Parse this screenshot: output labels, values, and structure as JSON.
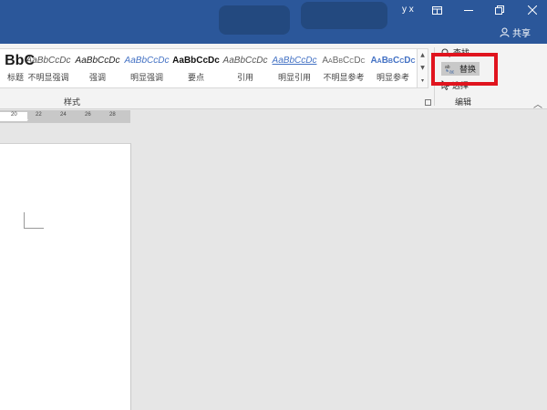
{
  "titlebar": {
    "user": "y x",
    "share_label": "共享"
  },
  "styles": {
    "group_label": "样式",
    "items": [
      {
        "sample": "BbC",
        "name": "标题"
      },
      {
        "sample": "AaBbCcDc",
        "name": "不明显强调"
      },
      {
        "sample": "AaBbCcDc",
        "name": "强调"
      },
      {
        "sample": "AaBbCcDc",
        "name": "明显强调"
      },
      {
        "sample": "AaBbCcDc",
        "name": "要点"
      },
      {
        "sample": "AaBbCcDc",
        "name": "引用"
      },
      {
        "sample": "AaBbCcDc",
        "name": "明显引用"
      },
      {
        "sample": "AaBbCcDc",
        "name": "不明显参考"
      },
      {
        "sample": "AaBbCcDc",
        "name": "明显参考"
      }
    ]
  },
  "editing": {
    "group_label": "编辑",
    "find_label": "查找",
    "replace_label": "替换",
    "select_label": "选择"
  },
  "ruler": {
    "labels": [
      "20",
      "22",
      "24",
      "26",
      "28"
    ]
  }
}
